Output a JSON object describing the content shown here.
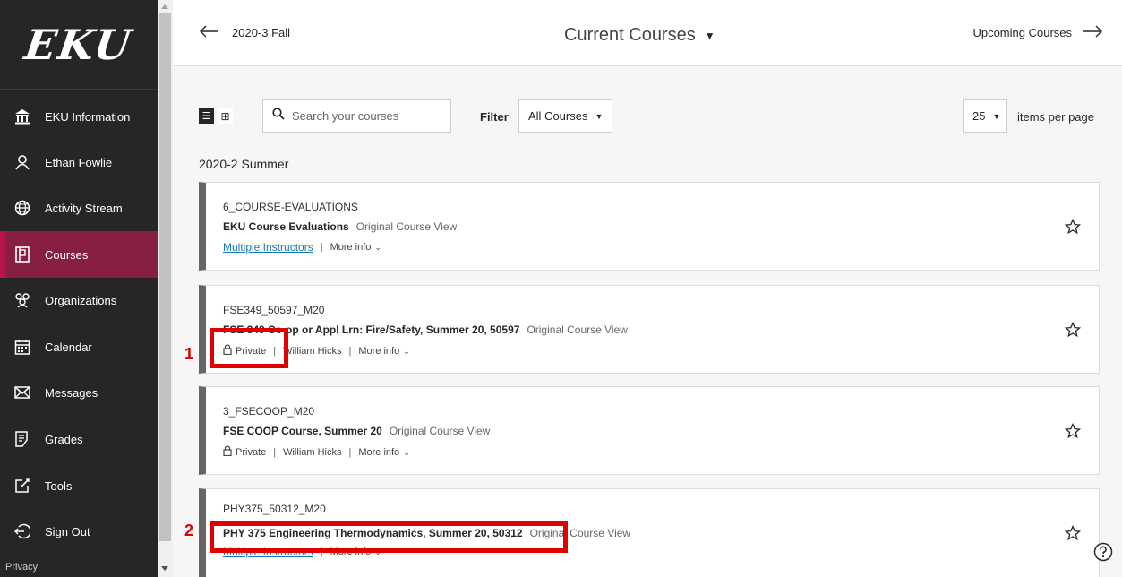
{
  "sidebar": {
    "logo": "EKU",
    "items": [
      {
        "label": "EKU Information",
        "icon": "bank-icon"
      },
      {
        "label": "Ethan Fowlie",
        "icon": "user-icon"
      },
      {
        "label": "Activity Stream",
        "icon": "globe-icon"
      },
      {
        "label": "Courses",
        "icon": "courses-icon"
      },
      {
        "label": "Organizations",
        "icon": "organizations-icon"
      },
      {
        "label": "Calendar",
        "icon": "calendar-icon"
      },
      {
        "label": "Messages",
        "icon": "envelope-icon"
      },
      {
        "label": "Grades",
        "icon": "grades-icon"
      },
      {
        "label": "Tools",
        "icon": "tools-icon"
      },
      {
        "label": "Sign Out",
        "icon": "sign-out-icon"
      }
    ],
    "active_item": "Courses",
    "privacy": "Privacy"
  },
  "header": {
    "prev_term": "2020-3 Fall",
    "title": "Current Courses",
    "next_label": "Upcoming Courses"
  },
  "toolbar": {
    "search_placeholder": "Search your courses",
    "filter_label": "Filter",
    "filter_value": "All Courses",
    "per_page_value": "25",
    "per_page_label": "items per page"
  },
  "term_heading": "2020-2 Summer",
  "courses": [
    {
      "code": "6_COURSE-EVALUATIONS",
      "title": "EKU Course Evaluations",
      "view": "Original Course View",
      "privacy": "",
      "instructor": "Multiple Instructors",
      "more": "More info"
    },
    {
      "code": "FSE349_50597_M20",
      "title": "FSE 349 Co-op or Appl Lrn: Fire/Safety, Summer 20, 50597",
      "view": "Original Course View",
      "privacy": "Private",
      "instructor": "William Hicks",
      "more": "More info"
    },
    {
      "code": "3_FSECOOP_M20",
      "title": "FSE COOP Course, Summer 20",
      "view": "Original Course View",
      "privacy": "Private",
      "instructor": "William Hicks",
      "more": "More info"
    },
    {
      "code": "PHY375_50312_M20",
      "title": "PHY 375 Engineering Thermodynamics, Summer 20, 50312",
      "view": "Original Course View",
      "privacy": "",
      "instructor": "Multiple Instructors",
      "more": "More info"
    }
  ],
  "annotations": [
    {
      "number": "1"
    },
    {
      "number": "2"
    }
  ],
  "colors": {
    "sidebar_bg": "#262626",
    "active_bg": "#861f41",
    "link": "#1577b6",
    "annotation": "#e00000"
  }
}
